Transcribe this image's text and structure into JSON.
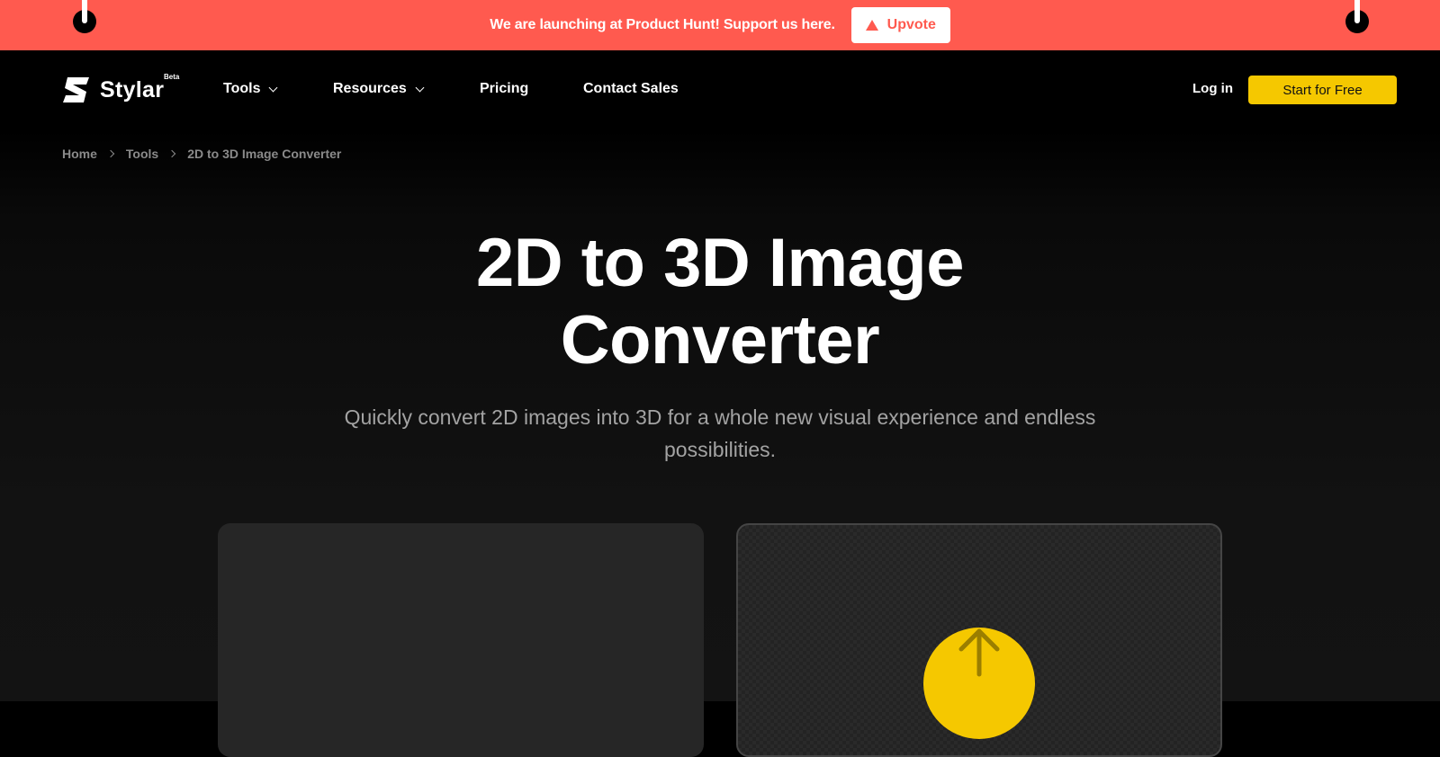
{
  "banner": {
    "message": "We are launching at Product Hunt! Support us here.",
    "upvote_label": "Upvote",
    "background_color": "#ff5a4f"
  },
  "nav": {
    "logo_text": "Stylar",
    "logo_badge": "Beta",
    "items": [
      {
        "label": "Tools",
        "has_dropdown": true
      },
      {
        "label": "Resources",
        "has_dropdown": true
      },
      {
        "label": "Pricing",
        "has_dropdown": false
      },
      {
        "label": "Contact Sales",
        "has_dropdown": false
      }
    ],
    "login_label": "Log in",
    "cta_label": "Start for Free",
    "cta_color": "#f5c800"
  },
  "breadcrumb": [
    "Home",
    "Tools",
    "2D to 3D Image Converter"
  ],
  "hero": {
    "title_line1": "2D to 3D Image",
    "title_line2": "Converter",
    "subtitle_line1": "Quickly convert 2D images into 3D for a whole new visual experience and endless",
    "subtitle_line2": "possibilities."
  },
  "upload": {
    "icon": "arrow-up-icon",
    "accent_color": "#f5c800"
  }
}
